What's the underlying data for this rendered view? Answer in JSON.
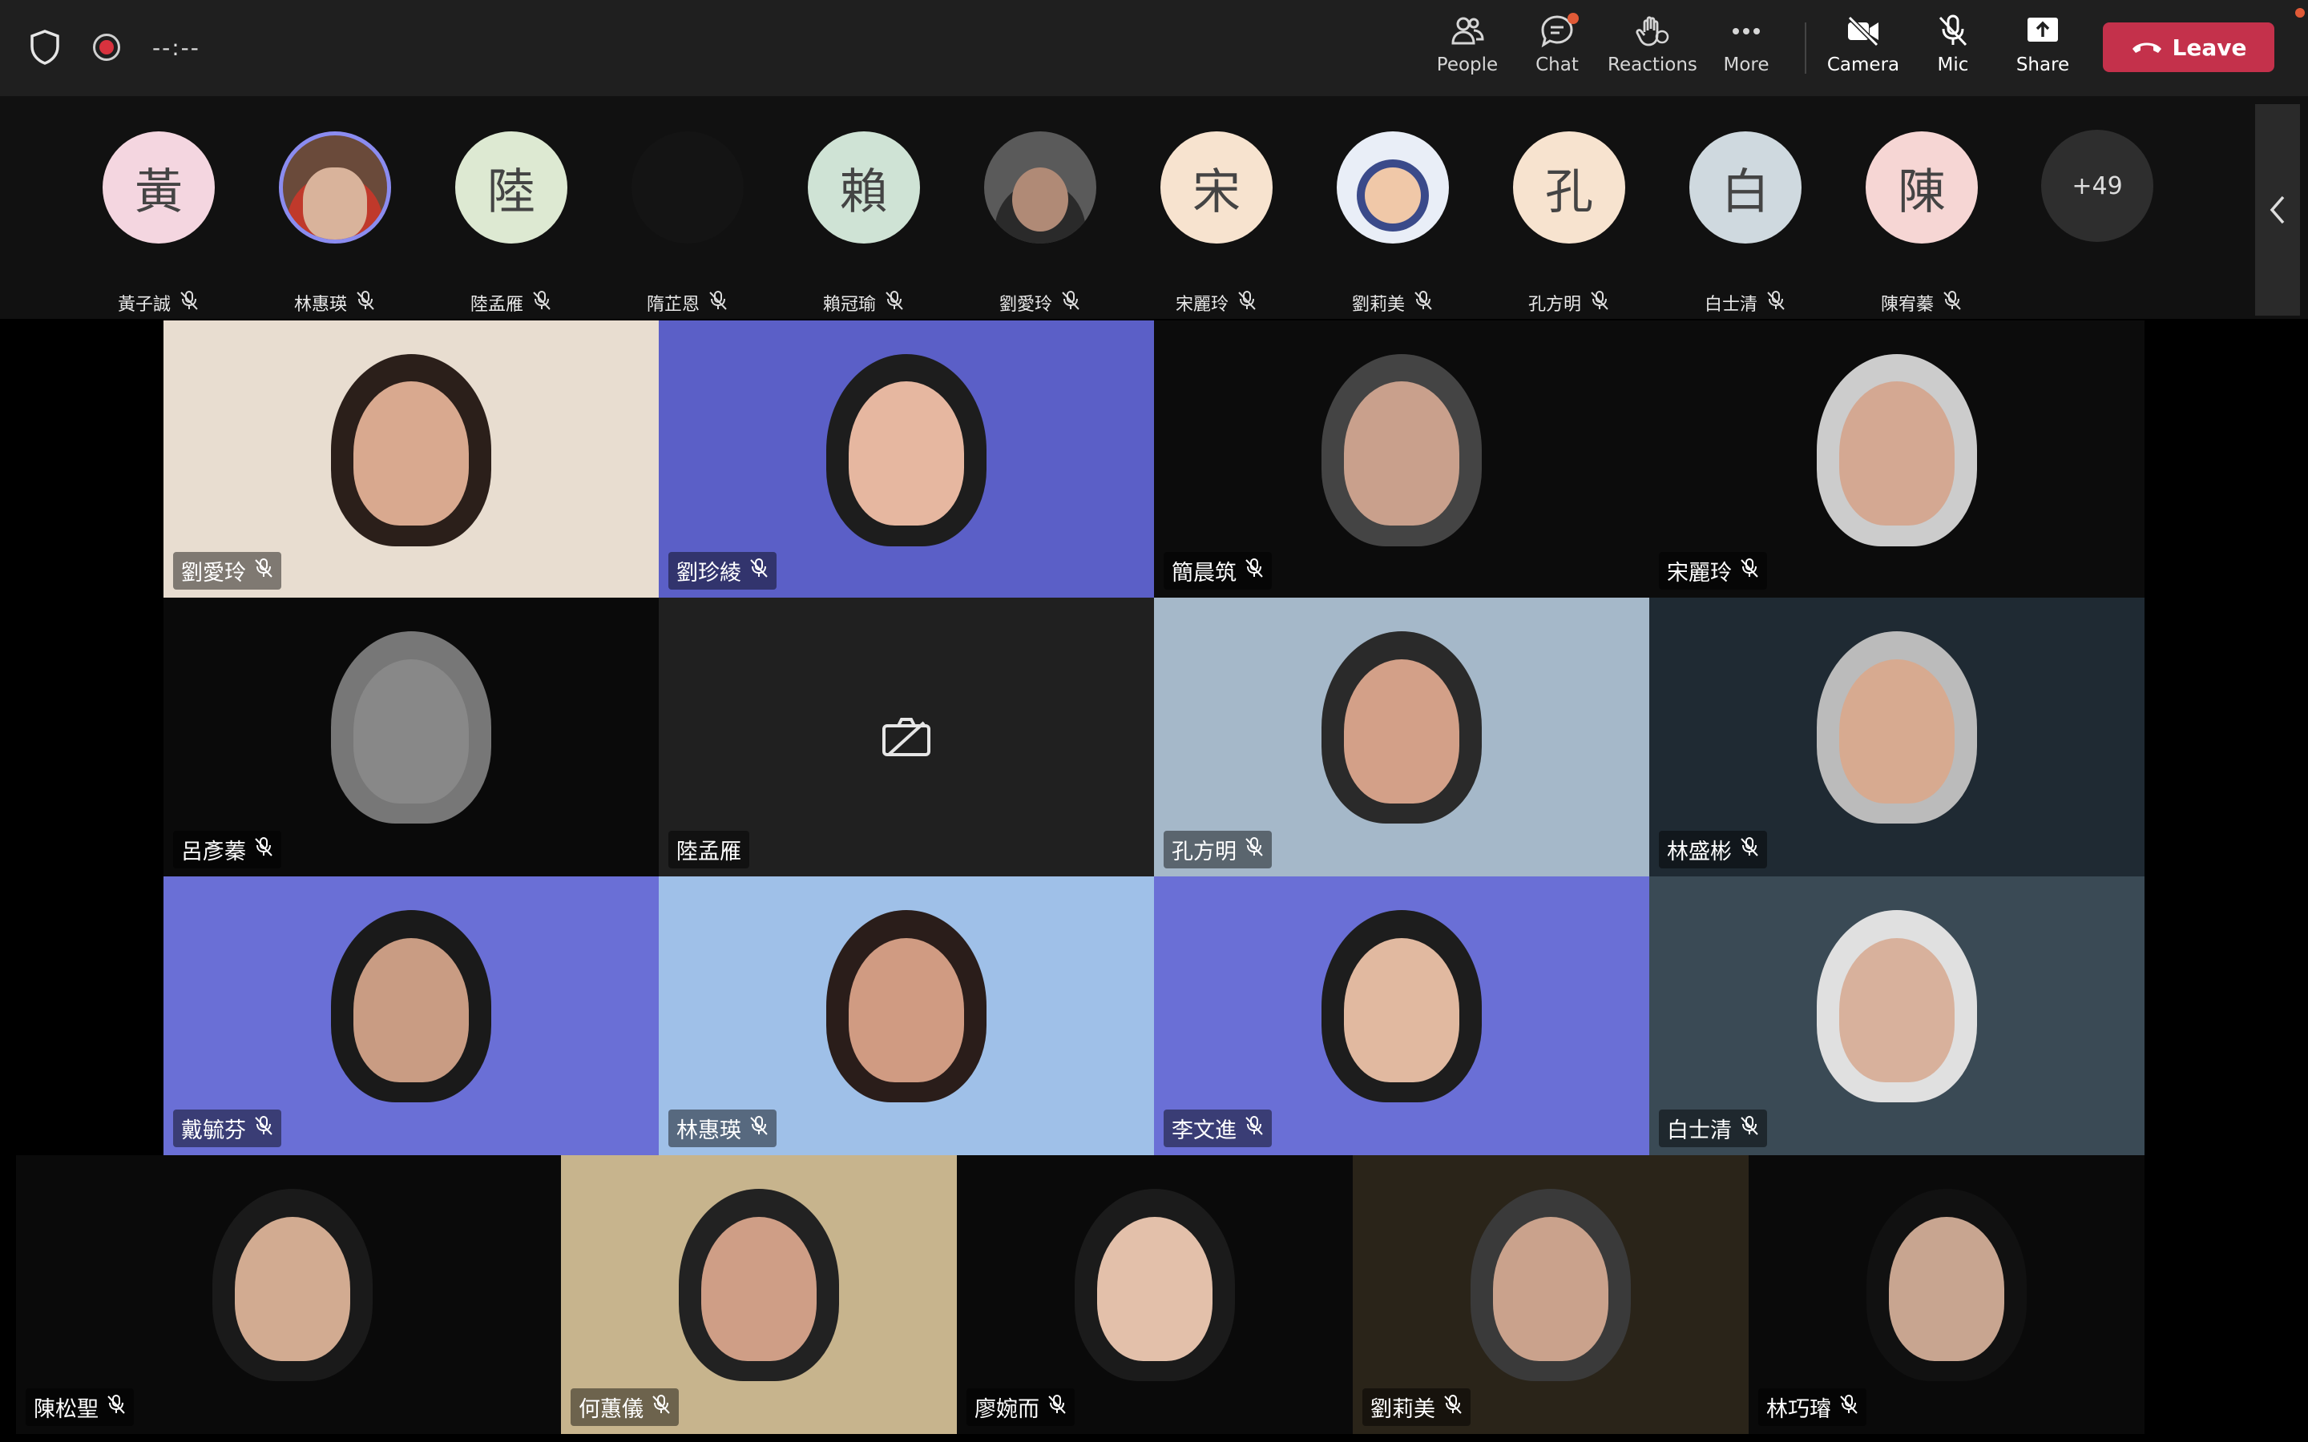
{
  "toolbar": {
    "timer": "--:--",
    "people": "People",
    "chat": "Chat",
    "reactions": "Reactions",
    "more": "More",
    "camera": "Camera",
    "mic": "Mic",
    "share": "Share",
    "leave": "Leave"
  },
  "strip": {
    "avatars": [
      {
        "initial": "黃",
        "name": "黃子誠",
        "bg": "#f4d6e0"
      },
      {
        "initial": "",
        "name": "林惠瑛",
        "bg": "#6a4a3a"
      },
      {
        "initial": "陸",
        "name": "陸孟雁",
        "bg": "#dde9d2"
      },
      {
        "initial": "",
        "name": "隋芷恩",
        "bg": "#141414"
      },
      {
        "initial": "賴",
        "name": "賴冠瑜",
        "bg": "#cfe3d5"
      },
      {
        "initial": "",
        "name": "劉愛玲",
        "bg": "#5a5a5a"
      },
      {
        "initial": "宋",
        "name": "宋麗玲",
        "bg": "#f7e3cf"
      },
      {
        "initial": "",
        "name": "劉莉美",
        "bg": "#e9eef7"
      },
      {
        "initial": "孔",
        "name": "孔方明",
        "bg": "#f7e3cf"
      },
      {
        "initial": "白",
        "name": "白士清",
        "bg": "#cfd9df"
      },
      {
        "initial": "陳",
        "name": "陳宥蓁",
        "bg": "#f6d6d4"
      }
    ],
    "more_count": "+49"
  },
  "tiles": [
    {
      "name": "劉愛玲"
    },
    {
      "name": "劉珍綾"
    },
    {
      "name": "簡晨筑"
    },
    {
      "name": "宋麗玲"
    },
    {
      "name": "呂彥蓁"
    },
    {
      "name": "陸孟雁"
    },
    {
      "name": "孔方明"
    },
    {
      "name": "林盛彬"
    },
    {
      "name": "戴毓芬"
    },
    {
      "name": "林惠瑛"
    },
    {
      "name": "李文進"
    },
    {
      "name": "白士清"
    },
    {
      "name": "陳松聖"
    },
    {
      "name": "何蕙儀"
    },
    {
      "name": "廖婉而"
    },
    {
      "name": "劉莉美"
    },
    {
      "name": "林巧璿"
    }
  ]
}
